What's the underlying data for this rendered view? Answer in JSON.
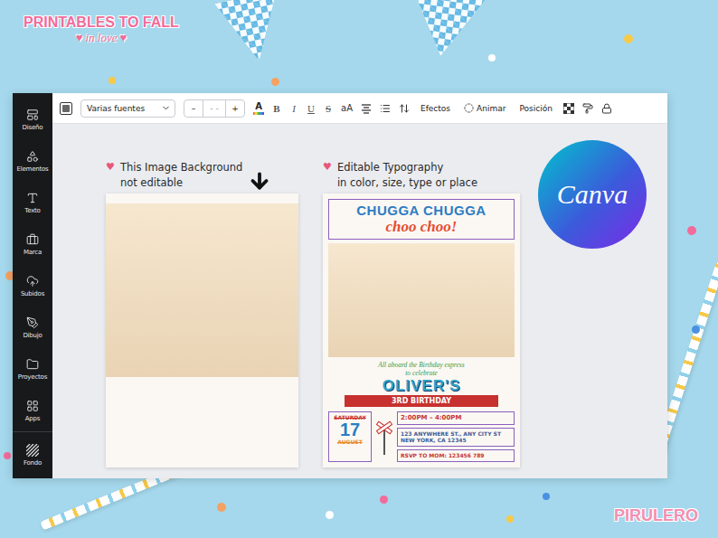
{
  "brand": {
    "title": "PRINTABLES TO FALL",
    "subtitle": "in love",
    "heart": "♥"
  },
  "watermark": "PIRULERO",
  "sidebar": {
    "items": [
      {
        "label": "Diseño"
      },
      {
        "label": "Elementos"
      },
      {
        "label": "Texto"
      },
      {
        "label": "Marca"
      },
      {
        "label": "Subidos"
      },
      {
        "label": "Dibujo"
      },
      {
        "label": "Proyectos"
      },
      {
        "label": "Apps"
      }
    ],
    "footer": "Fondo"
  },
  "toolbar": {
    "font": "Varias fuentes",
    "size_minus": "–",
    "size_value": "- -",
    "size_plus": "+",
    "color_letter": "A",
    "bold": "B",
    "italic": "I",
    "underline": "U",
    "strike": "S",
    "case": "aA",
    "effects": "Efectos",
    "animate": "Animar",
    "position": "Posición"
  },
  "labels": [
    {
      "heart": "♥",
      "lines": [
        "This Image Background",
        "not editable"
      ]
    },
    {
      "heart": "♥",
      "lines": [
        "Editable Typography",
        "in color, size, type or place"
      ]
    }
  ],
  "canva_logo": "Canva",
  "invitation": {
    "title_1": "CHUGGA CHUGGA",
    "title_2": "choo choo!",
    "tagline_1": "All aboard the Birthday express",
    "tagline_2": "to celebrate",
    "name": "OLIVER'S",
    "occasion": "3RD BIRTHDAY",
    "day": "SATURDAY",
    "date": "17",
    "month": "AUGUST",
    "time": "2:00PM – 4:00PM",
    "address": [
      "123 ANYWHERE ST., ANY CITY ST",
      "NEW YORK, CA 12345"
    ],
    "rsvp": "RSVP TO MOM: 123456 789"
  }
}
